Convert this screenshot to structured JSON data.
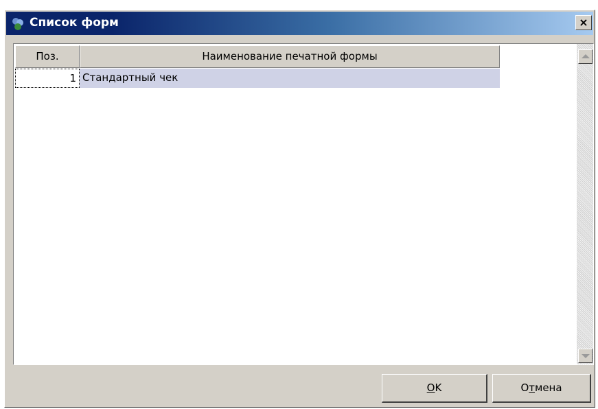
{
  "window": {
    "title": "Список форм",
    "close_label": "×"
  },
  "grid": {
    "columns": [
      {
        "label": "Поз."
      },
      {
        "label": "Наименование печатной формы"
      }
    ],
    "rows": [
      {
        "pos": "1",
        "name": "Стандартный чек",
        "selected": true
      }
    ]
  },
  "buttons": {
    "ok": {
      "mnemonic": "O",
      "rest": "K"
    },
    "cancel": {
      "pre": "О",
      "mnemonic": "т",
      "rest": "мена"
    }
  },
  "icons": {
    "app": "form-list-icon",
    "close": "close-icon",
    "scroll_up": "scroll-up-arrow-icon",
    "scroll_down": "scroll-down-arrow-icon"
  },
  "colors": {
    "title_left": "#0a246a",
    "title_right": "#a6caf0",
    "face": "#d4d0c8",
    "selection": "#cfd2e6"
  }
}
